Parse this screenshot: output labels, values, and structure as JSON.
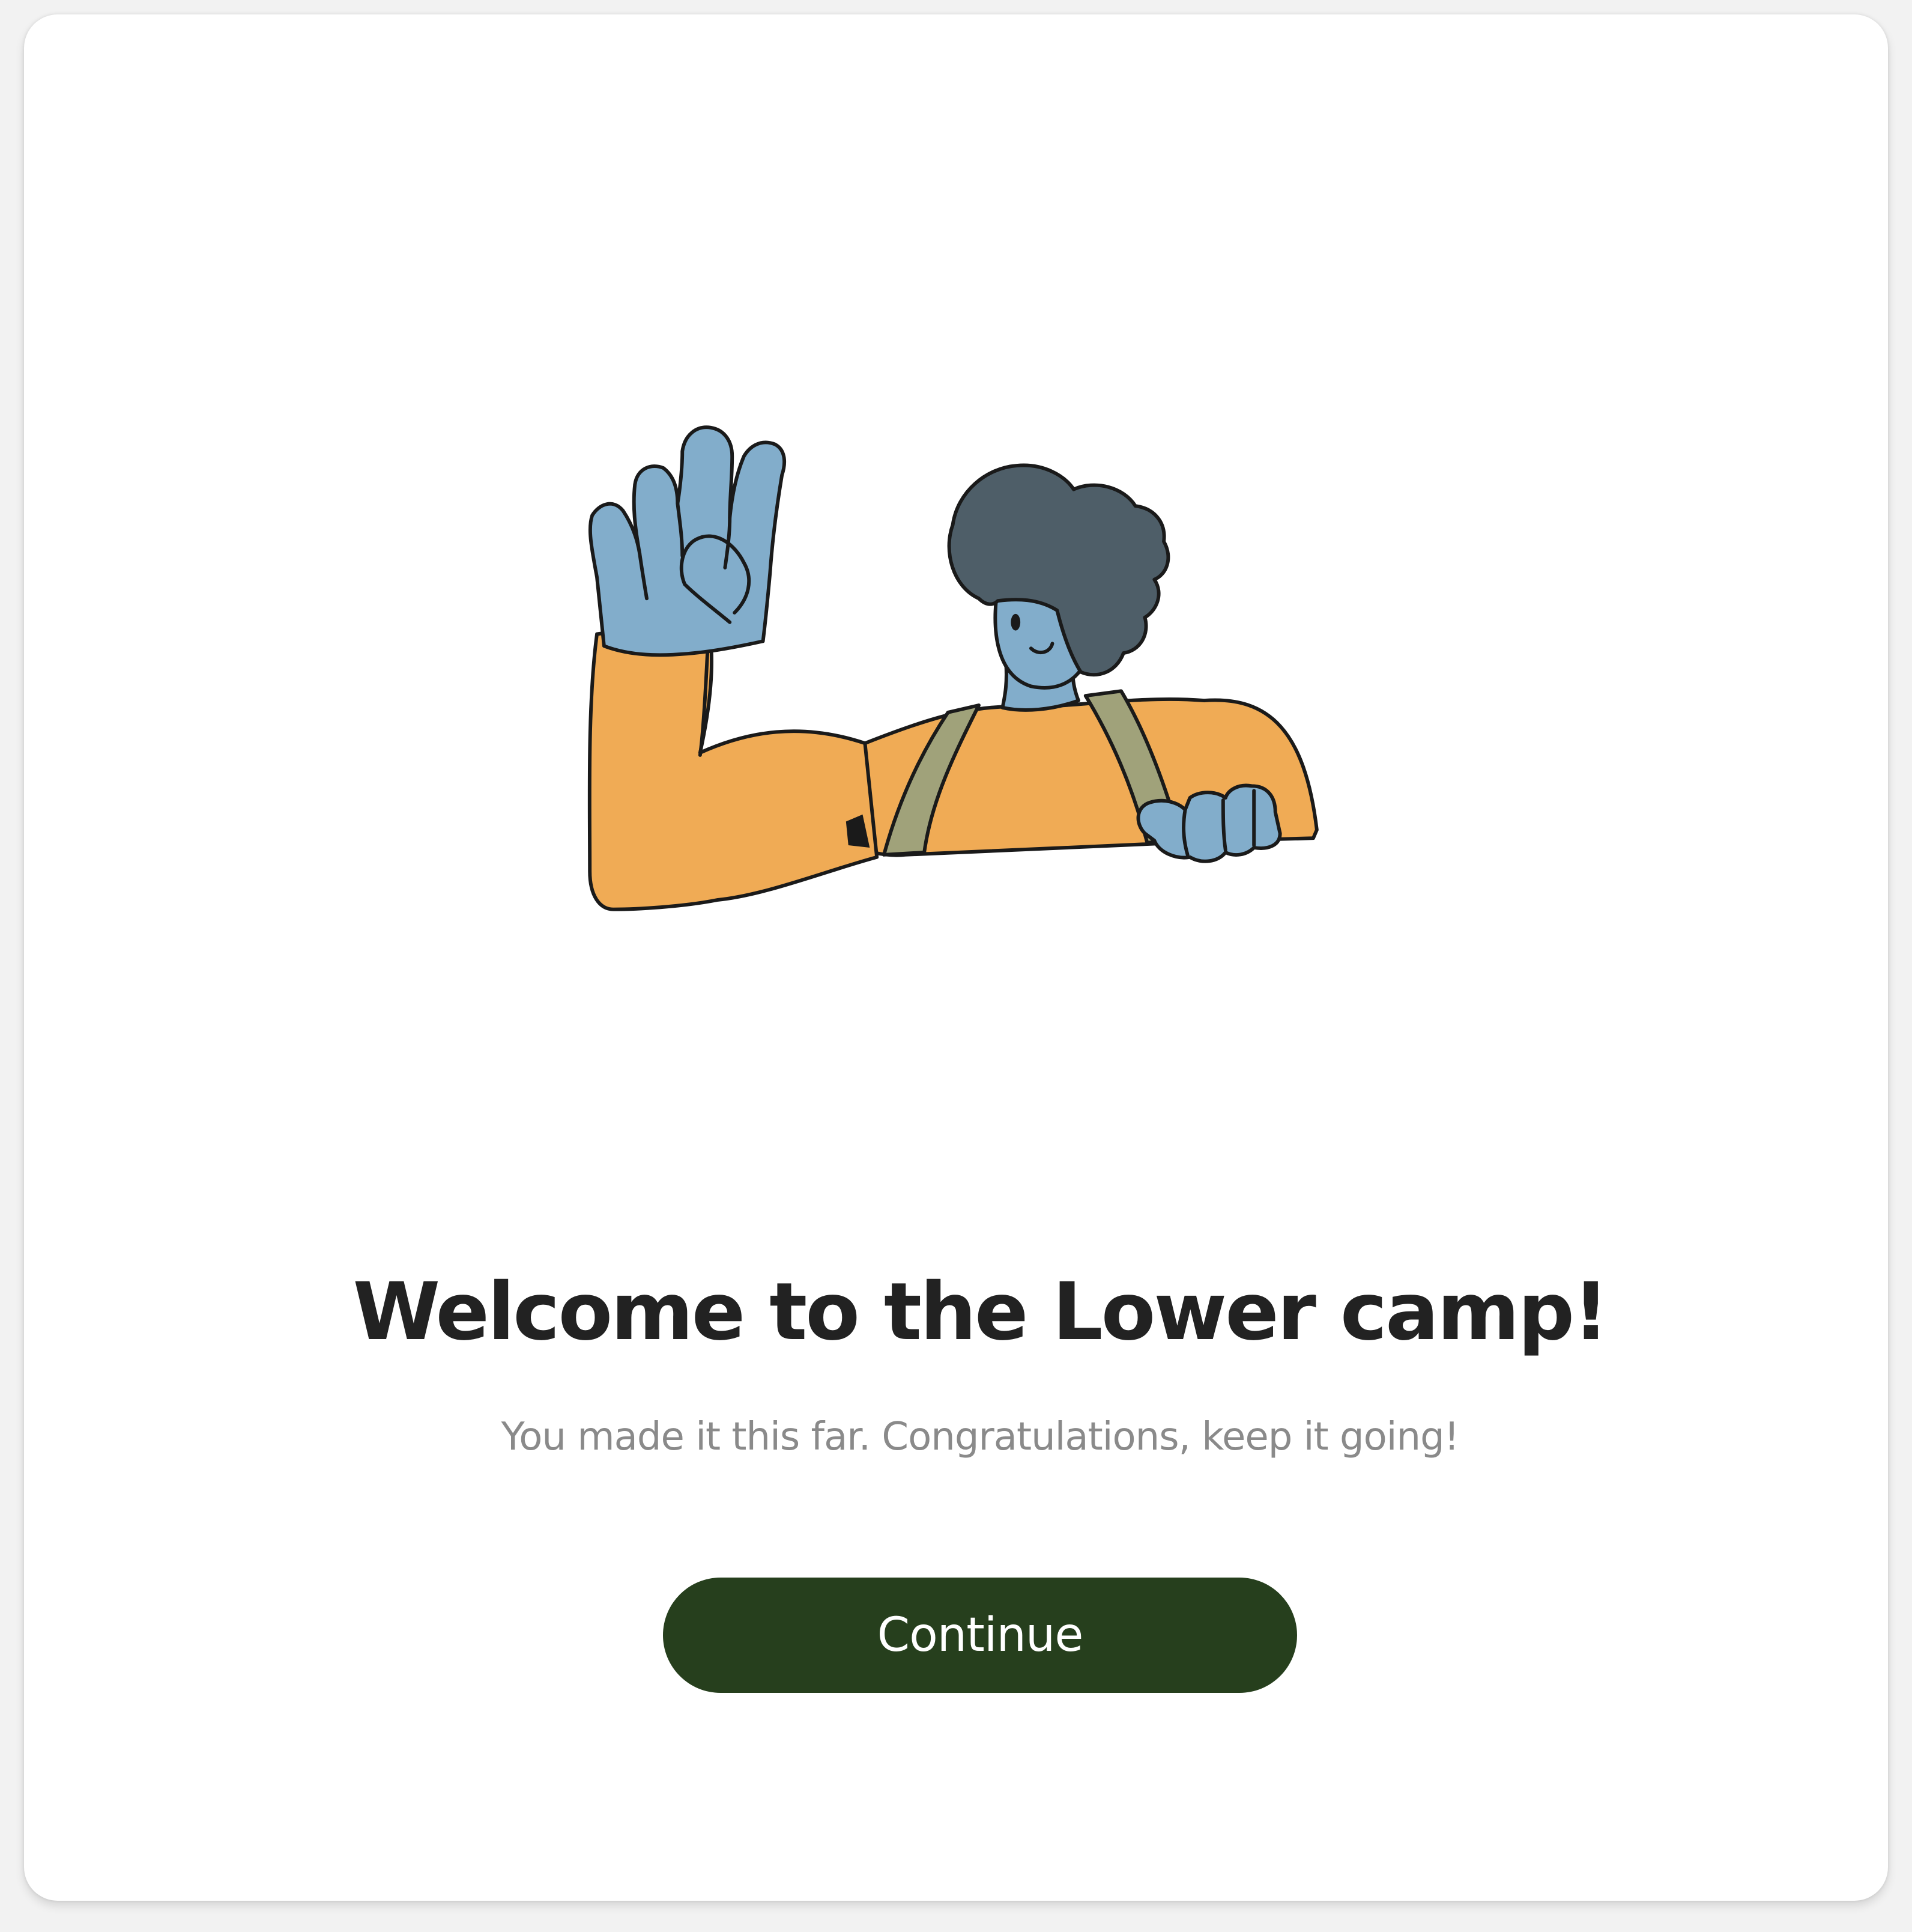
{
  "welcome": {
    "title": "Welcome to the Lower camp!",
    "subtitle": "You made it this far. Congratulations, keep it going!",
    "continue_label": "Continue"
  },
  "colors": {
    "button_bg": "#263f1d",
    "shirt": "#f0ab55",
    "skin": "#82adcb",
    "hair": "#4e5e68",
    "suspenders": "#a0a27a"
  },
  "illustration": {
    "icon": "waving-person-illustration"
  }
}
